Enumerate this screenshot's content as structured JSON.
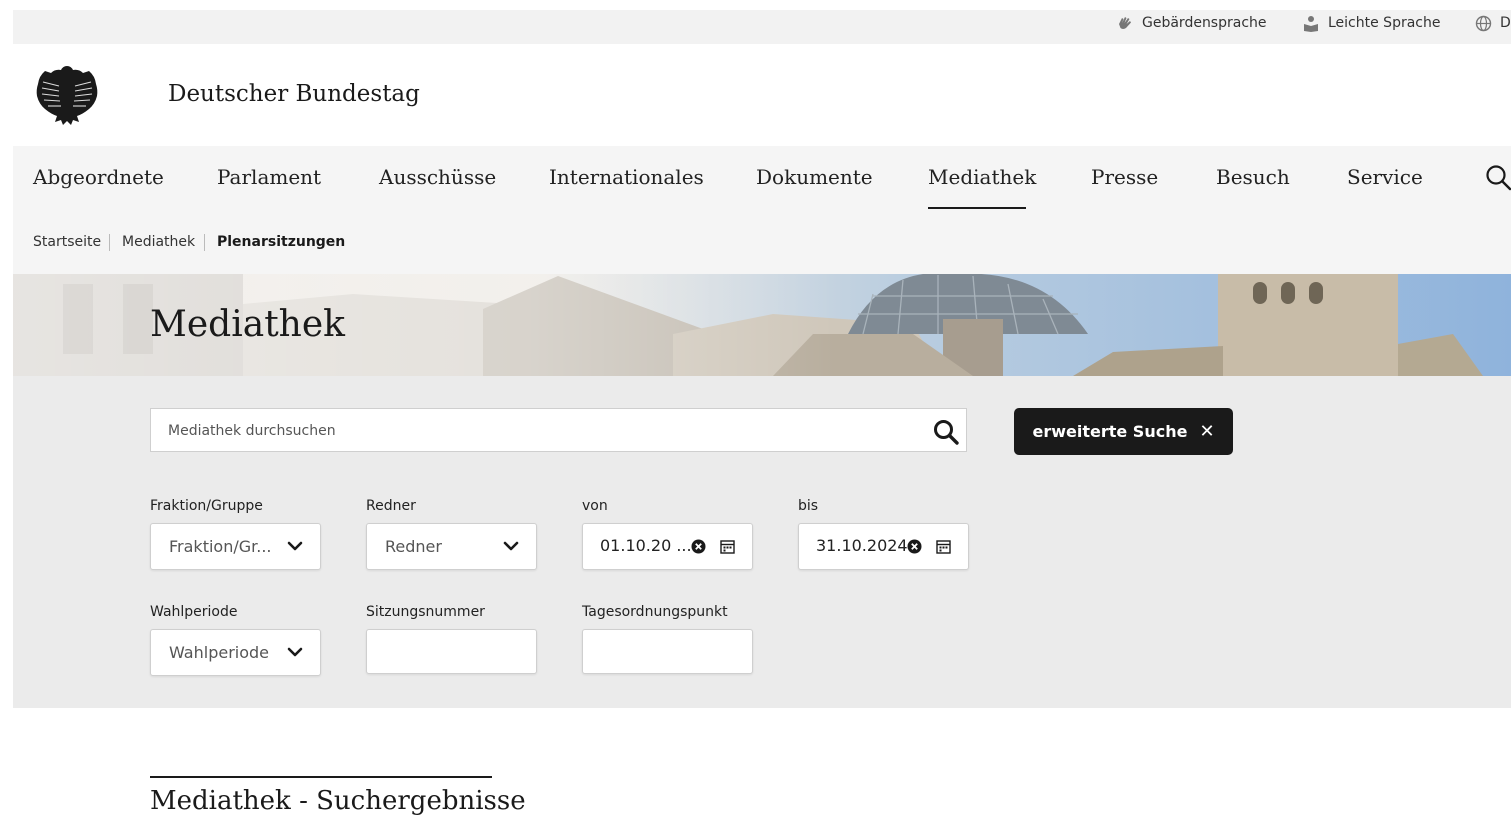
{
  "utility": {
    "sign_language": "Gebärdensprache",
    "easy_language": "Leichte Sprache",
    "language": "D"
  },
  "header": {
    "title": "Deutscher Bundestag"
  },
  "nav": {
    "items": [
      "Abgeordnete",
      "Parlament",
      "Ausschüsse",
      "Internationales",
      "Dokumente",
      "Mediathek",
      "Presse",
      "Besuch",
      "Service"
    ],
    "active": "Mediathek"
  },
  "breadcrumb": {
    "items": [
      "Startseite",
      "Mediathek",
      "Plenarsitzungen"
    ]
  },
  "hero": {
    "title": "Mediathek"
  },
  "search": {
    "placeholder": "Mediathek durchsuchen",
    "advanced_label": "erweiterte Suche",
    "advanced_close": "✕"
  },
  "filters": {
    "fraktion": {
      "label": "Fraktion/Gruppe",
      "value": "Fraktion/Gr..."
    },
    "redner": {
      "label": "Redner",
      "value": "Redner"
    },
    "von": {
      "label": "von",
      "value": "01.10.20 ..."
    },
    "bis": {
      "label": "bis",
      "value": "31.10.2024"
    },
    "wahlperiode": {
      "label": "Wahlperiode",
      "value": "Wahlperiode"
    },
    "sitzungsnummer": {
      "label": "Sitzungsnummer",
      "value": ""
    },
    "tagesordnungspunkt": {
      "label": "Tagesordnungspunkt",
      "value": ""
    }
  },
  "results": {
    "title": "Mediathek - Suchergebnisse"
  },
  "colors": {
    "accent_dark": "#1a1a1a",
    "panel_bg": "#ebebeb",
    "nav_bg": "#f5f5f5"
  }
}
